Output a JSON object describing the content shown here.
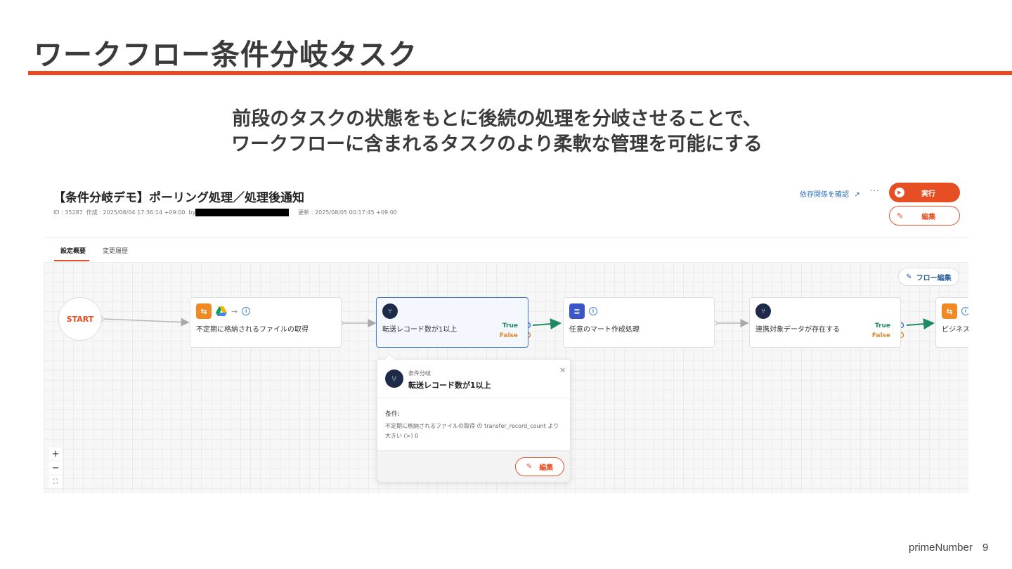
{
  "slide": {
    "title": "ワークフロー条件分岐タスク",
    "subtitle_line1": "前段のタスクの状態をもとに後続の処理を分岐させることで、",
    "subtitle_line2": "ワークフローに含まれるタスクのより柔軟な管理を可能にする",
    "accent_color": "#ea4b24",
    "footer_brand": "primeNumber",
    "page_number": "9"
  },
  "workflow": {
    "title": "【条件分岐デモ】ポーリング処理／処理後通知",
    "id_text": "ID : 35287",
    "created_text": "作成 : 2025/08/04 17:36:14 +09:00",
    "created_by_label": "by",
    "updated_text": "更新 : 2025/08/05 00:17:45 +09:00",
    "dependency_link": "依存関係を確認",
    "more_label": "···",
    "run_button": "実行",
    "edit_button": "編集",
    "tabs": [
      {
        "label": "設定概要",
        "active": true
      },
      {
        "label": "変更履歴",
        "active": false
      }
    ]
  },
  "canvas": {
    "flow_edit_button": "フロー編集",
    "start_label": "START",
    "nodes": [
      {
        "label": "不定期に格納されるファイルの取得",
        "icons": [
          "transfer-icon",
          "google-drive-icon",
          "arrow-right-icon",
          "info-icon"
        ]
      },
      {
        "label": "転送レコード数が1以上",
        "icons": [
          "branch-icon"
        ],
        "true_label": "True",
        "false_label": "False",
        "selected": true
      },
      {
        "label": "任意のマート作成処理",
        "icons": [
          "database-icon",
          "info-icon"
        ]
      },
      {
        "label": "連携対象データが存在する",
        "icons": [
          "branch-icon"
        ],
        "true_label": "True",
        "false_label": "False"
      },
      {
        "label": "ビジネス",
        "icons": [
          "transfer-icon",
          "info-icon"
        ]
      }
    ],
    "popup": {
      "kicker": "条件分岐",
      "title": "転送レコード数が1以上",
      "condition_label": "条件:",
      "condition_text": "不定期に格納されるファイルの取得 の transfer_record_count より大きい (>) 0",
      "edit_button": "編集",
      "close_label": "×"
    },
    "zoom": {
      "in": "+",
      "out": "−",
      "fit": "⛶"
    },
    "colors": {
      "true": "#1e8a66",
      "false": "#d98a2a",
      "selected_border": "#3d78d8"
    }
  }
}
